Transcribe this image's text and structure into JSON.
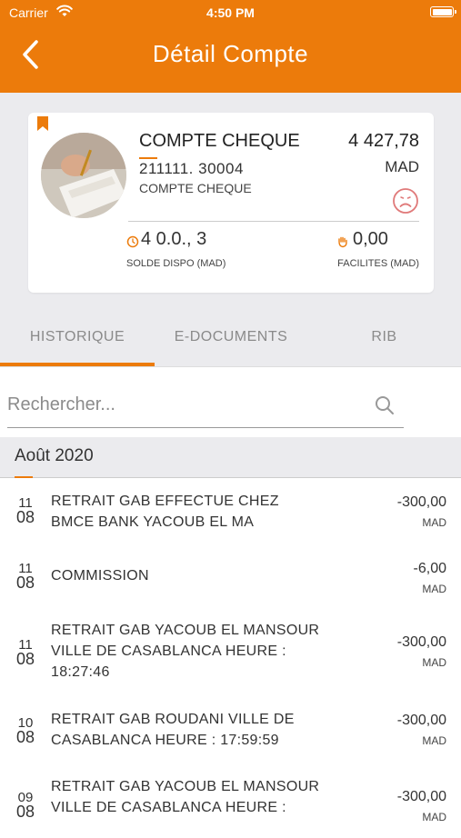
{
  "status_bar": {
    "carrier": "Carrier",
    "time": "4:50 PM"
  },
  "nav": {
    "title": "Détail Compte",
    "back_icon": "chevron-left-icon"
  },
  "account": {
    "type": "COMPTE CHEQUE",
    "number": "211111.          30004",
    "label": "COMPTE CHEQUE",
    "balance": "4 427,78",
    "currency": "MAD",
    "solde_value": "4 0.0.,   3",
    "solde_label": "SOLDE DISPO (MAD)",
    "facilites_value": "0,00",
    "facilites_label": "FACILITES (MAD)",
    "colors": {
      "accent": "#ec7b0b",
      "sad_icon": "#e07a7a"
    }
  },
  "tabs": [
    {
      "label": "HISTORIQUE",
      "active": true
    },
    {
      "label": "E-DOCUMENTS",
      "active": false
    },
    {
      "label": "RIB",
      "active": false
    }
  ],
  "search": {
    "placeholder": "Rechercher..."
  },
  "month": {
    "label": "Août 2020"
  },
  "transactions": [
    {
      "day": "11",
      "month": "08",
      "description": "RETRAIT GAB EFFECTUE CHEZ BMCE BANK YACOUB EL MA",
      "amount": "-300,00",
      "currency": "MAD"
    },
    {
      "day": "11",
      "month": "08",
      "description": "COMMISSION",
      "amount": "-6,00",
      "currency": "MAD"
    },
    {
      "day": "11",
      "month": "08",
      "description": "RETRAIT GAB YACOUB EL MANSOUR VILLE DE CASABLANCA HEURE : 18:27:46",
      "amount": "-300,00",
      "currency": "MAD"
    },
    {
      "day": "10",
      "month": "08",
      "description": "RETRAIT GAB ROUDANI VILLE DE CASABLANCA HEURE : 17:59:59",
      "amount": "-300,00",
      "currency": "MAD"
    },
    {
      "day": "09",
      "month": "08",
      "description": "RETRAIT GAB YACOUB EL MANSOUR VILLE DE CASABLANCA HEURE :",
      "amount": "-300,00",
      "currency": "MAD"
    }
  ]
}
